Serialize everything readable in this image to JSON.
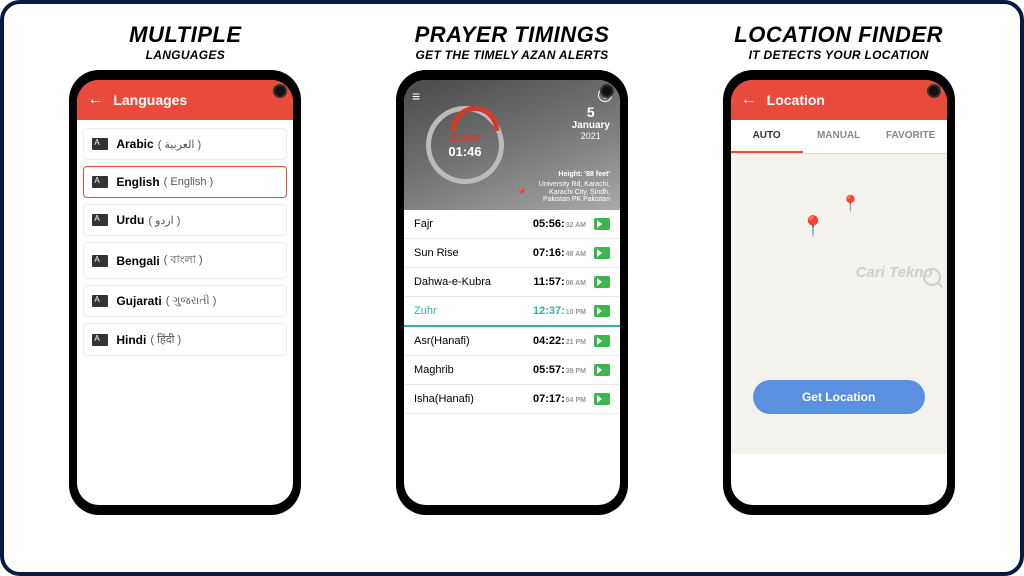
{
  "panel1": {
    "titleBig": "MULTIPLE",
    "titleSmall": "LANGUAGES",
    "appbar": "Languages",
    "langs": [
      {
        "name": "Arabic",
        "native": "( العربية )",
        "selected": false
      },
      {
        "name": "English",
        "native": "( English )",
        "selected": true
      },
      {
        "name": "Urdu",
        "native": "( اردو )",
        "selected": false
      },
      {
        "name": "Bengali",
        "native": "( বাংলা )",
        "selected": false
      },
      {
        "name": "Gujarati",
        "native": "( ગુજરાતી )",
        "selected": false
      },
      {
        "name": "Hindi",
        "native": "( हिंदी )",
        "selected": false
      }
    ]
  },
  "panel2": {
    "titleBig": "PRAYER TIMINGS",
    "titleSmall": "GET THE TIMELY AZAN ALERTS",
    "clock": {
      "label": "Zuhar",
      "time": "01:46"
    },
    "date": {
      "day": "5",
      "month": "January",
      "year": "2021"
    },
    "height": "Height: '88 feet'",
    "location": "University Rd, Karachi,\nKarachi City, Sindh,\nPakistan PK Pakistan",
    "prayers": [
      {
        "name": "Fajr",
        "time": "05:56:",
        "ampm": "32 AM",
        "active": false
      },
      {
        "name": "Sun Rise",
        "time": "07:16:",
        "ampm": "48 AM",
        "active": false
      },
      {
        "name": "Dahwa-e-Kubra",
        "time": "11:57:",
        "ampm": "06 AM",
        "active": false
      },
      {
        "name": "Zuhr",
        "time": "12:37:",
        "ampm": "10 PM",
        "active": true
      },
      {
        "name": "Asr(Hanafi)",
        "time": "04:22:",
        "ampm": "21 PM",
        "active": false
      },
      {
        "name": "Maghrib",
        "time": "05:57:",
        "ampm": "39 PM",
        "active": false
      },
      {
        "name": "Isha(Hanafi)",
        "time": "07:17:",
        "ampm": "54 PM",
        "active": false
      }
    ]
  },
  "panel3": {
    "titleBig": "LOCATION FINDER",
    "titleSmall": "IT DETECTS YOUR LOCATION",
    "appbar": "Location",
    "tabs": [
      {
        "label": "AUTO",
        "active": true
      },
      {
        "label": "MANUAL",
        "active": false
      },
      {
        "label": "FAVORITE",
        "active": false
      }
    ],
    "buttonLabel": "Get Location",
    "watermark": "Cari Tekno"
  }
}
